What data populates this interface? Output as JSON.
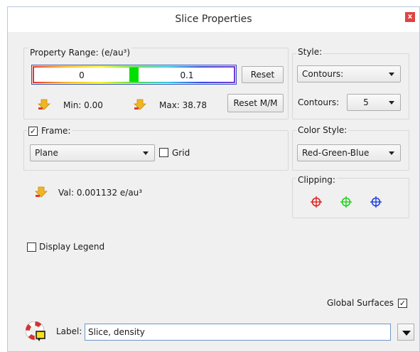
{
  "window": {
    "title": "Slice Properties",
    "close_label": "x"
  },
  "property_range": {
    "group_label": "Property Range: (e/au³)",
    "min_value": "0",
    "max_value": "0.1",
    "reset_label": "Reset",
    "min_text": "Min: 0.00",
    "max_text": "Max: 38.78",
    "reset_mm_label": "Reset M/M"
  },
  "style": {
    "group_label": "Style:",
    "type_value": "Contours:",
    "contours_label": "Contours:",
    "contours_value": "5"
  },
  "frame": {
    "checked": true,
    "label": "Frame:",
    "plane_value": "Plane",
    "grid_label": "Grid",
    "grid_checked": false
  },
  "color_style": {
    "group_label": "Color Style:",
    "value": "Red-Green-Blue"
  },
  "value_text": "Val: 0.001132  e/au³",
  "clipping": {
    "group_label": "Clipping:",
    "icons": [
      "crosshair-red-icon",
      "crosshair-green-icon",
      "crosshair-blue-icon"
    ],
    "colors": [
      "#e02020",
      "#20d020",
      "#2040e0"
    ]
  },
  "legend": {
    "label": "Display Legend",
    "checked": false
  },
  "global_surfaces": {
    "label": "Global Surfaces",
    "checked": true
  },
  "label_field": {
    "label": "Label:",
    "value": "Slice, density"
  },
  "icons": {
    "arrow": "pick-arrow-icon",
    "help": "lifebuoy-help-icon"
  }
}
